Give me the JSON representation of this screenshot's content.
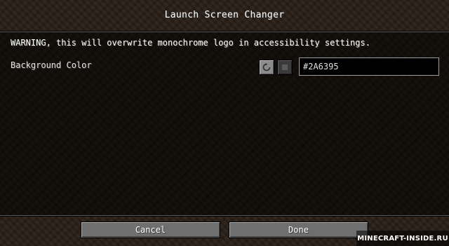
{
  "screen": {
    "title": "Launch Screen Changer"
  },
  "content": {
    "warning": "WARNING, this will overwrite monochrome logo in accessibility settings.",
    "background_color": {
      "label": "Background Color",
      "reset_icon": "reset-arrow-icon",
      "swatch_color": "#2A6395",
      "value": "#2A6395"
    }
  },
  "footer": {
    "cancel_label": "Cancel",
    "done_label": "Done"
  },
  "watermark": {
    "text": "MINECRAFT-INSIDE.RU"
  },
  "colors": {
    "background_dirt": "#2b2118",
    "list_background": "#120e0a",
    "button": "#6f6f6f",
    "text": "#ffffff"
  }
}
